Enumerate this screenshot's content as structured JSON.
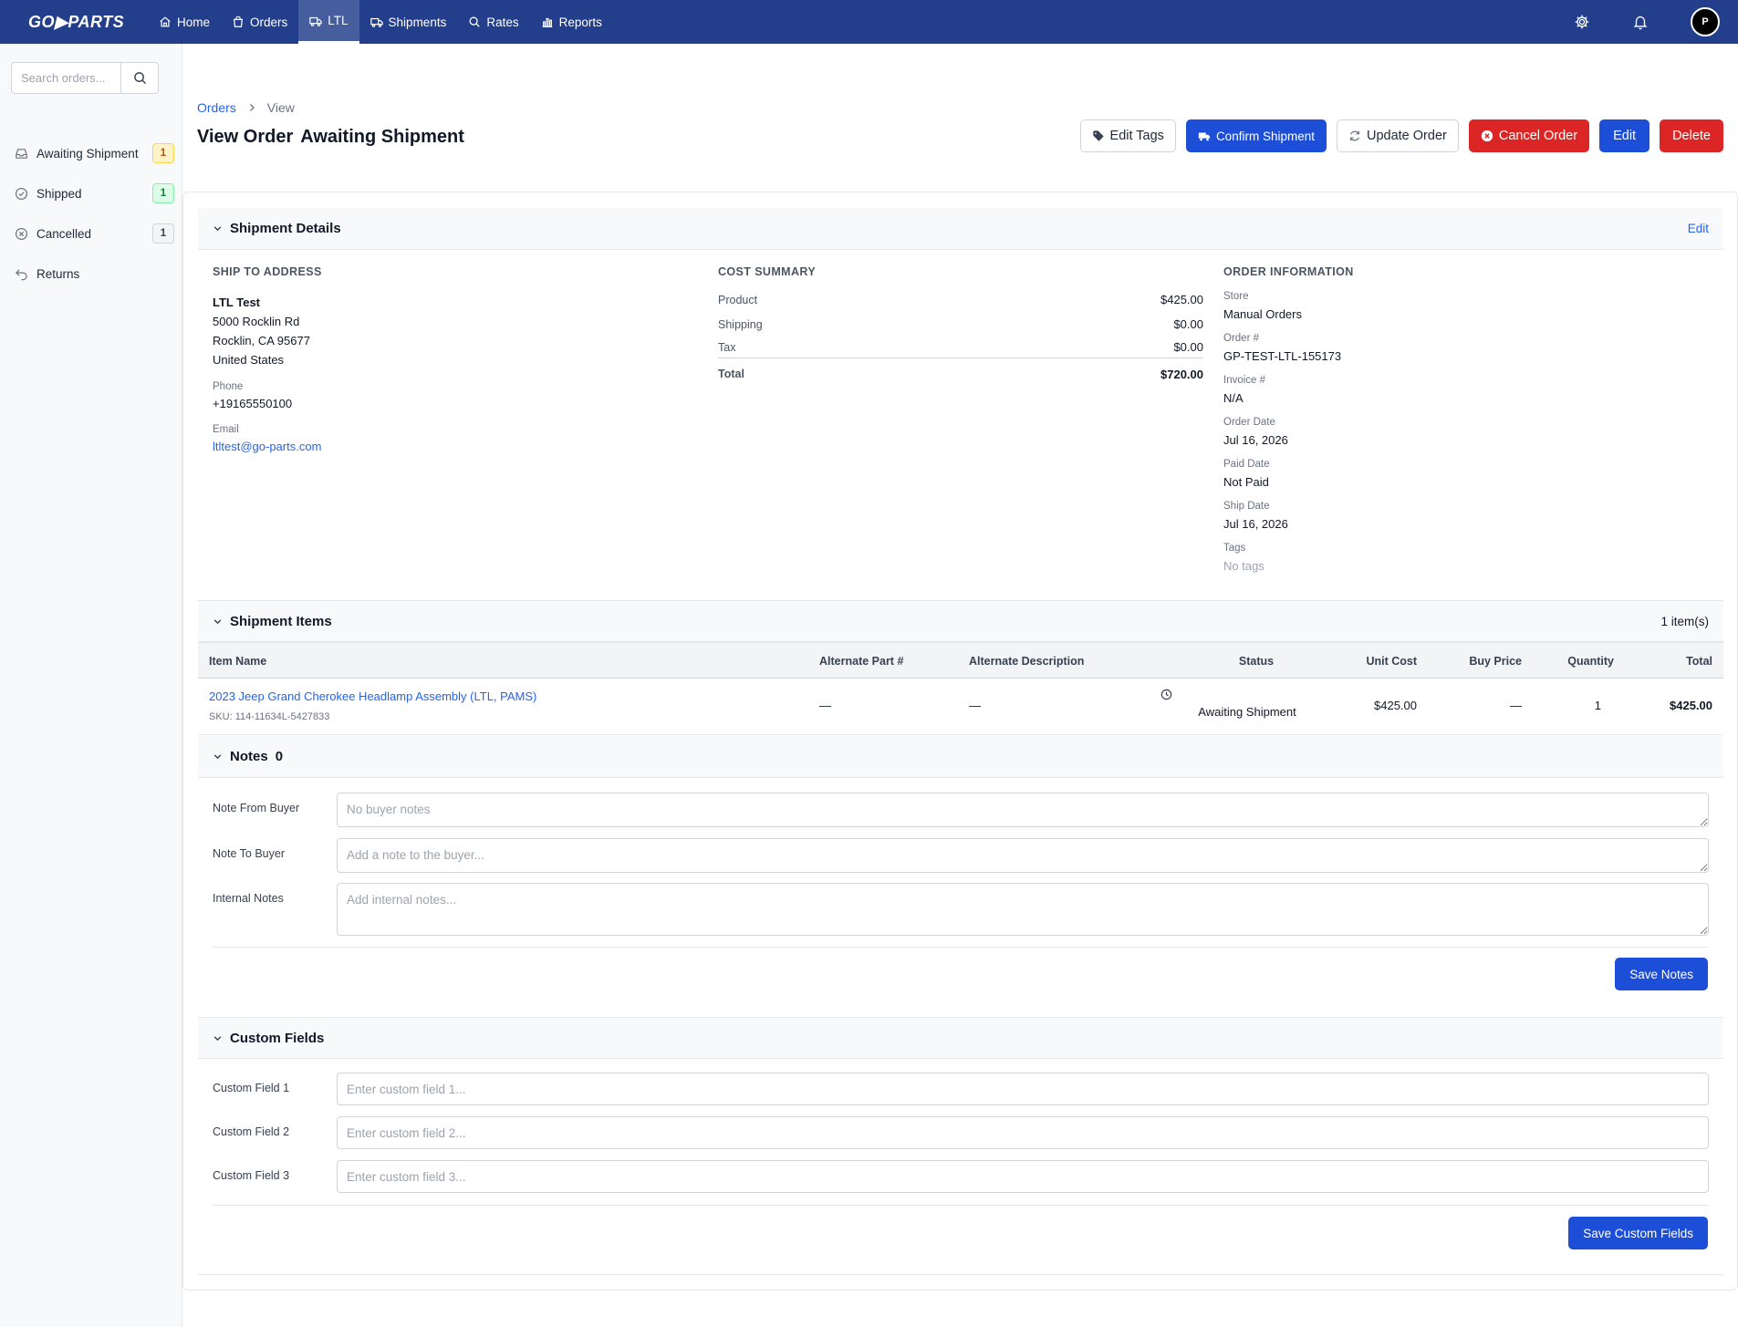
{
  "nav": {
    "logo": "GO▶PARTS",
    "links": [
      {
        "label": "Home",
        "icon": "home-icon"
      },
      {
        "label": "Orders",
        "icon": "bag-icon"
      },
      {
        "label": "LTL",
        "icon": "truck-icon"
      },
      {
        "label": "Shipments",
        "icon": "truck-icon"
      },
      {
        "label": "Rates",
        "icon": "search-icon"
      },
      {
        "label": "Reports",
        "icon": "bar-chart-icon"
      }
    ],
    "active": "LTL",
    "avatar_initial": "P"
  },
  "sidebar": {
    "search_placeholder": "Search orders...",
    "items": [
      {
        "label": "Awaiting Shipment",
        "count": "1",
        "icon": "inbox-icon"
      },
      {
        "label": "Shipped",
        "count": "1",
        "icon": "check-circle-icon"
      },
      {
        "label": "Cancelled",
        "count": "1",
        "icon": "x-circle-icon"
      },
      {
        "label": "Returns",
        "icon": "return-icon"
      }
    ]
  },
  "header": {
    "breadcrumb": {
      "parent": "Orders",
      "current": "View"
    },
    "title": "View Order",
    "status": "Awaiting Shipment",
    "buttons": {
      "edit_tags": "Edit Tags",
      "confirm_shipment": "Confirm Shipment",
      "update_order": "Update Order",
      "cancel_order": "Cancel Order",
      "edit": "Edit",
      "delete": "Delete"
    }
  },
  "shipment_details": {
    "title": "Shipment Details",
    "edit_label": "Edit",
    "ship_to": {
      "heading": "SHIP TO ADDRESS",
      "name": "LTL Test",
      "street": "5000 Rocklin Rd",
      "city": "Rocklin, CA 95677",
      "country": "United States",
      "phone_label": "Phone",
      "phone": "+19165550100",
      "email_label": "Email",
      "email": "ltltest@go-parts.com"
    },
    "cost_summary": {
      "heading": "COST SUMMARY",
      "rows": [
        {
          "label": "Product",
          "value": "$425.00"
        },
        {
          "label": "Shipping",
          "value": "$0.00"
        },
        {
          "label": "Tax",
          "value": "$0.00"
        }
      ],
      "total_label": "Total",
      "total_value": "$720.00"
    },
    "order_info": {
      "heading": "ORDER INFORMATION",
      "fields": [
        {
          "label": "Store",
          "value": "Manual Orders"
        },
        {
          "label": "Order #",
          "value": "GP-TEST-LTL-155173"
        },
        {
          "label": "Invoice #",
          "value": "N/A"
        },
        {
          "label": "Order Date",
          "value": "Jul 16, 2026"
        },
        {
          "label": "Paid Date",
          "value": "Not Paid"
        },
        {
          "label": "Ship Date",
          "value": "Jul 16, 2026"
        },
        {
          "label": "Tags",
          "value": "No tags"
        }
      ]
    }
  },
  "shipment_items": {
    "title": "Shipment Items",
    "count_label": "1 item(s)",
    "columns": [
      "Item Name",
      "Alternate Part #",
      "Alternate Description",
      "Status",
      "Unit Cost",
      "Buy Price",
      "Quantity",
      "Total"
    ],
    "rows": [
      {
        "name": "2023 Jeep Grand Cherokee Headlamp Assembly (LTL, PAMS)",
        "sku": "SKU: 114-11634L-5427833",
        "alt_part": "—",
        "alt_desc": "—",
        "status": "Awaiting Shipment",
        "unit_cost": "$425.00",
        "buy_price": "—",
        "quantity": "1",
        "total": "$425.00"
      }
    ]
  },
  "notes": {
    "title": "Notes",
    "count": "0",
    "from_buyer_label": "Note From Buyer",
    "from_buyer_placeholder": "No buyer notes",
    "to_buyer_label": "Note To Buyer",
    "to_buyer_placeholder": "Add a note to the buyer...",
    "internal_label": "Internal Notes",
    "internal_placeholder": "Add internal notes...",
    "save_label": "Save Notes"
  },
  "custom_fields": {
    "title": "Custom Fields",
    "fields": [
      {
        "label": "Custom Field 1",
        "placeholder": "Enter custom field 1..."
      },
      {
        "label": "Custom Field 2",
        "placeholder": "Enter custom field 2..."
      },
      {
        "label": "Custom Field 3",
        "placeholder": "Enter custom field 3..."
      }
    ],
    "save_label": "Save Custom Fields"
  },
  "colors": {
    "nav_bg": "#233f8c",
    "primary": "#1d4ed8",
    "danger": "#dc2626",
    "link": "#2563eb",
    "badge_awaiting": "#d97706",
    "badge_shipped": "#16a34a"
  }
}
